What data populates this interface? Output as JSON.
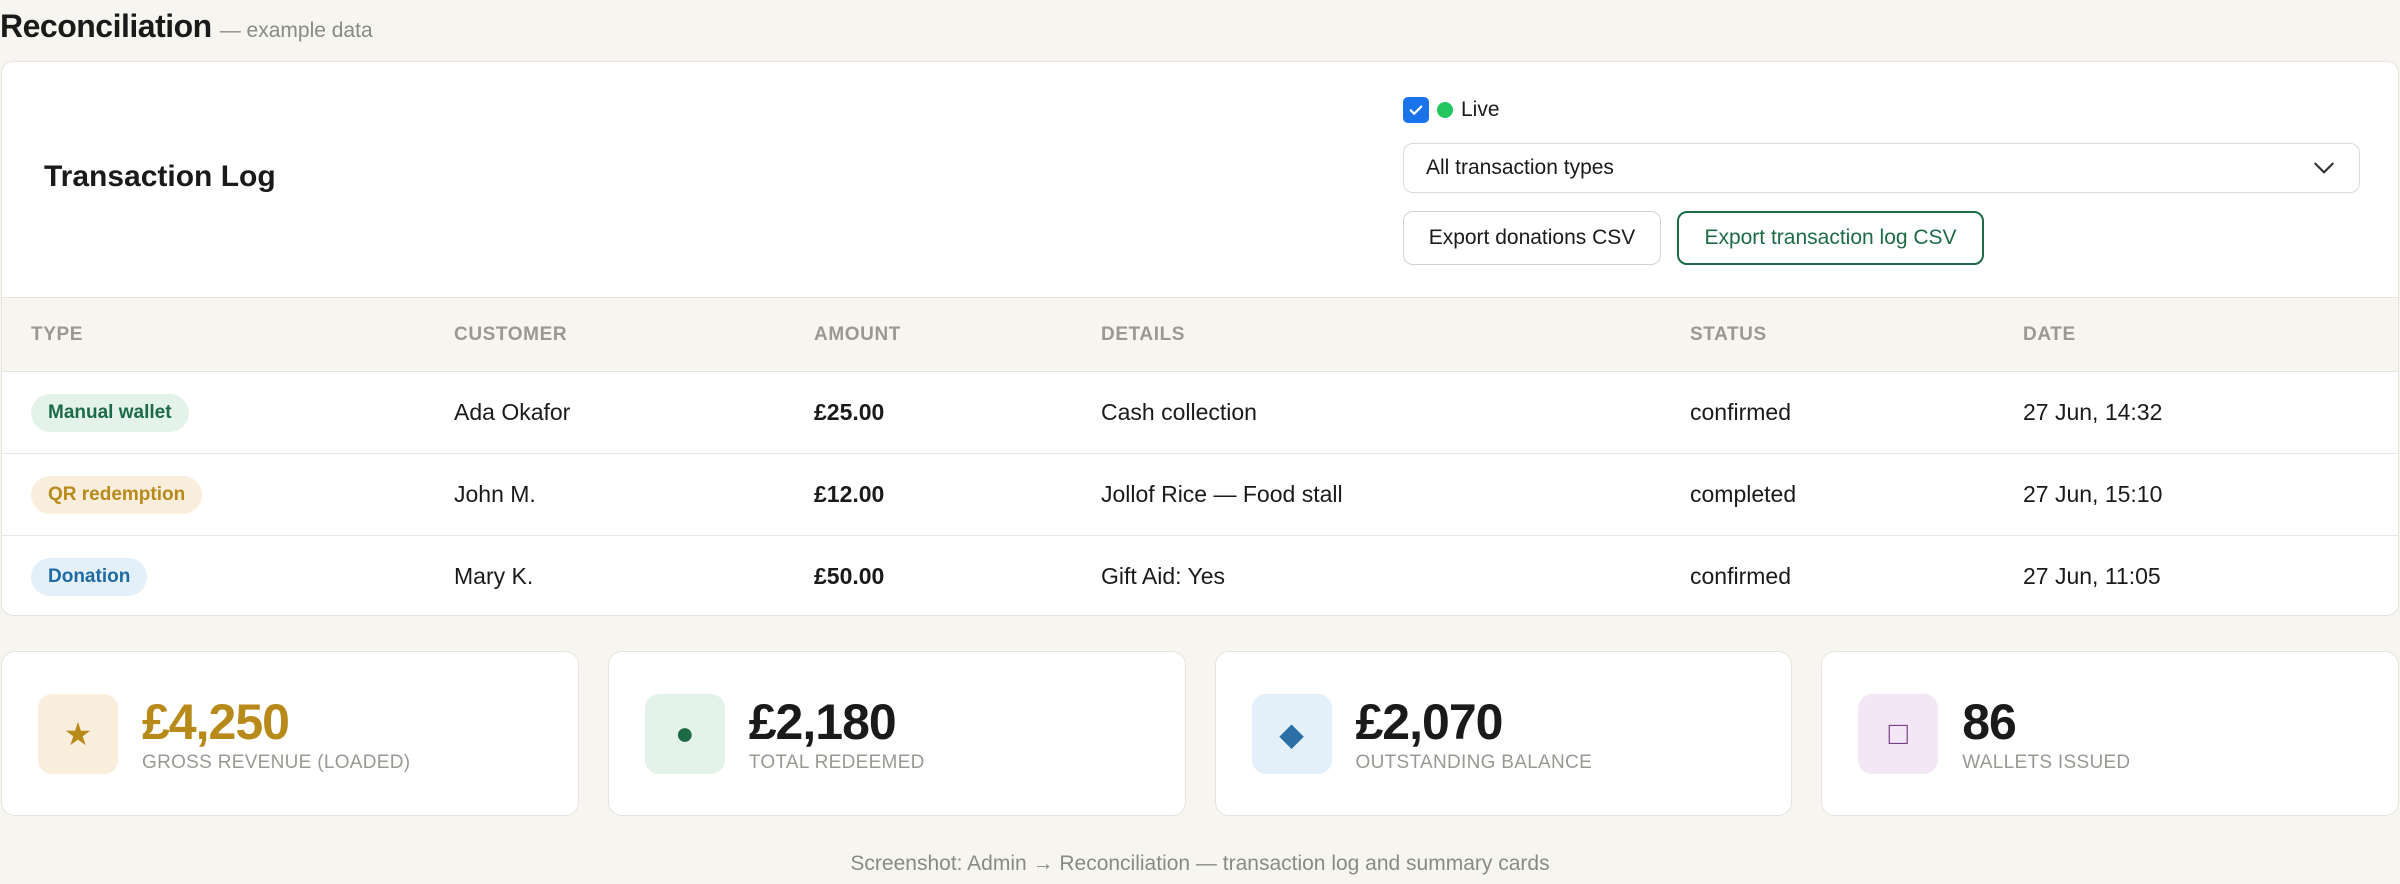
{
  "page": {
    "title": "Reconciliation",
    "subtitle": "— example data"
  },
  "panel": {
    "title": "Transaction Log",
    "live_label": "Live",
    "live_checked": true,
    "filter": {
      "selected": "All transaction types"
    },
    "buttons": {
      "export_donations": "Export donations CSV",
      "export_log": "Export transaction log CSV"
    }
  },
  "table": {
    "columns": [
      "TYPE",
      "CUSTOMER",
      "AMOUNT",
      "DETAILS",
      "STATUS",
      "DATE"
    ],
    "rows": [
      {
        "type": "Manual wallet",
        "customer": "Ada Okafor",
        "amount": "£25.00",
        "details": "Cash collection",
        "status": "confirmed",
        "date": "27 Jun, 14:32"
      },
      {
        "type": "QR redemption",
        "customer": "John M.",
        "amount": "£12.00",
        "details": "Jollof Rice — Food stall",
        "status": "completed",
        "date": "27 Jun, 15:10"
      },
      {
        "type": "Donation",
        "customer": "Mary K.",
        "amount": "£50.00",
        "details": "Gift Aid: Yes",
        "status": "confirmed",
        "date": "27 Jun, 11:05"
      }
    ]
  },
  "cards": [
    {
      "value": "£4,250",
      "label": "GROSS REVENUE (LOADED)",
      "icon": "star-icon",
      "glyph": "★",
      "color": "#b88a1a",
      "bg": "#f8eedb"
    },
    {
      "value": "£2,180",
      "label": "TOTAL REDEEMED",
      "icon": "dot-icon",
      "glyph": "●",
      "color": "#1c6b46",
      "bg": "#e4f3ea"
    },
    {
      "value": "£2,070",
      "label": "OUTSTANDING BALANCE",
      "icon": "diamond-icon",
      "glyph": "◆",
      "color": "#2a6fa5",
      "bg": "#e3f0fa"
    },
    {
      "value": "86",
      "label": "WALLETS ISSUED",
      "icon": "square-icon",
      "glyph": "□",
      "color": "#7a3f86",
      "bg": "#f3e7f5"
    }
  ],
  "colors": {
    "accent_green": "#1c6b46",
    "live_dot": "#22c55e",
    "checkbox_blue": "#1a73e8"
  },
  "footer": "Screenshot: Admin → Reconciliation — transaction log and summary cards"
}
